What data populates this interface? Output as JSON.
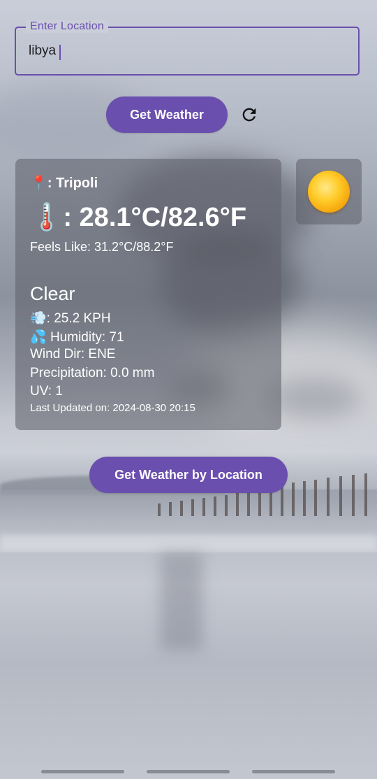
{
  "input": {
    "label": "Enter Location",
    "value": "libya"
  },
  "buttons": {
    "get_weather": "Get Weather",
    "get_weather_by_location": "Get Weather by Location"
  },
  "icons": {
    "refresh": "refresh-icon",
    "pin": "📍",
    "thermometer": "🌡️",
    "wind": "💨",
    "humidity": "💦",
    "condition": "sun-icon"
  },
  "weather": {
    "city": "Tripoli",
    "temperature": "28.1°C/82.6°F",
    "feels_like": "Feels Like: 31.2°C/88.2°F",
    "condition": "Clear",
    "wind": "25.2 KPH",
    "humidity": "Humidity: 71",
    "wind_dir": "Wind Dir: ENE",
    "precipitation": "Precipitation: 0.0 mm",
    "uv": "UV: 1",
    "last_updated": "Last Updated on: 2024-08-30 20:15"
  },
  "colors": {
    "accent": "#6a4fae",
    "sun": "#ffcc2a"
  }
}
